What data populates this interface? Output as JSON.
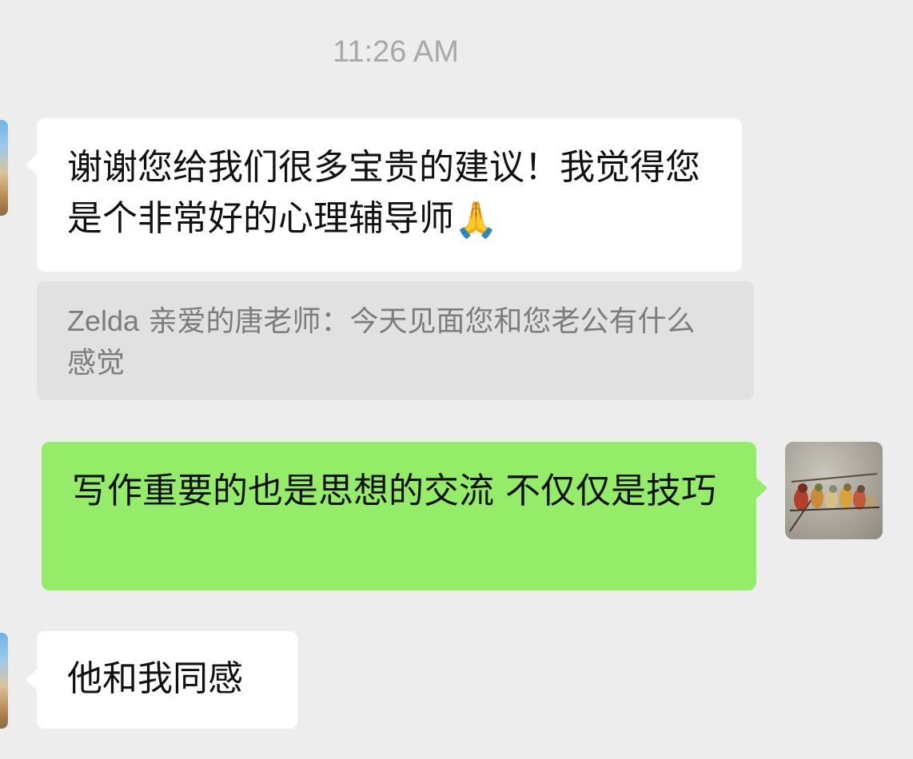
{
  "chat": {
    "timestamp": "11:26 AM",
    "messages": [
      {
        "direction": "incoming",
        "text": "谢谢您给我们很多宝贵的建议！我觉得您是个非常好的心理辅导师",
        "emoji": "🙏"
      },
      {
        "direction": "outgoing",
        "text": "写作重要的也是思想的交流 不仅仅是技巧"
      },
      {
        "direction": "incoming",
        "text": "他和我同感"
      }
    ],
    "quote": {
      "sender": "Zelda",
      "text": "亲爱的唐老师：今天见面您和您老公有什么感觉"
    }
  },
  "icons": {
    "left_avatar": "contact-avatar-icon",
    "right_avatar": "self-avatar-icon"
  },
  "colors": {
    "background": "#ededed",
    "incoming_bubble": "#ffffff",
    "outgoing_bubble": "#95ec69",
    "quote_background": "#e1e1e1",
    "timestamp_text": "#a8a8a8",
    "quote_text": "#7c7c7c"
  }
}
